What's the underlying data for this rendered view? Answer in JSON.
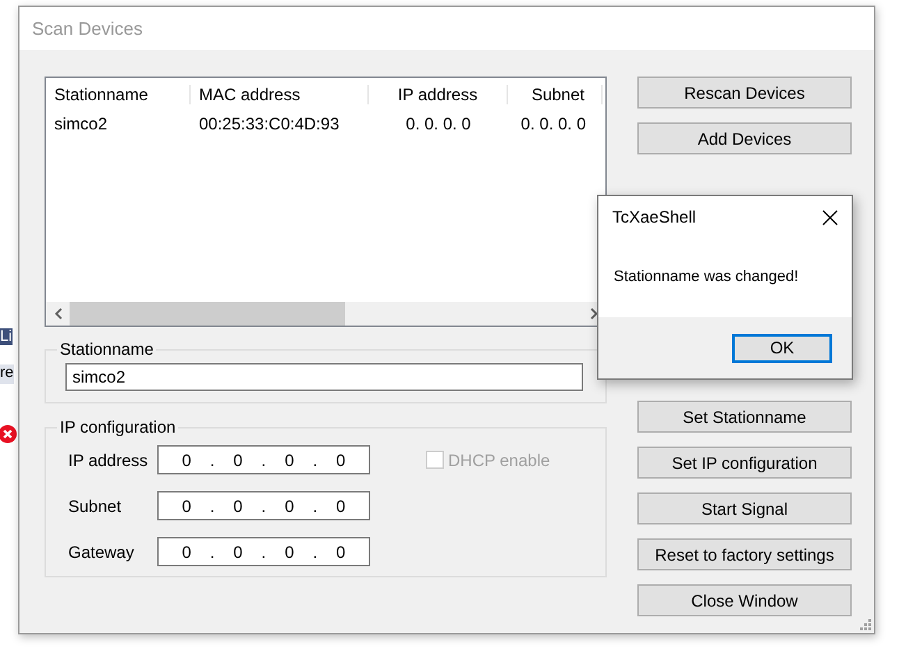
{
  "background": {
    "tab_label": "Li",
    "row_label": "re"
  },
  "dialog": {
    "title": "Scan Devices",
    "device_list": {
      "columns": [
        "Stationname",
        "MAC address",
        "IP address",
        "Subnet"
      ],
      "rows": [
        [
          "simco2",
          "00:25:33:C0:4D:93",
          "0. 0. 0. 0",
          "0. 0. 0. 0"
        ]
      ]
    },
    "stationname_group": {
      "label": "Stationname",
      "value": "simco2"
    },
    "ip_group": {
      "label": "IP configuration",
      "fields": [
        {
          "label": "IP address",
          "octets": [
            "0",
            "0",
            "0",
            "0"
          ],
          "separator": "."
        },
        {
          "label": "Subnet",
          "octets": [
            "0",
            "0",
            "0",
            "0"
          ],
          "separator": "."
        },
        {
          "label": "Gateway",
          "octets": [
            "0",
            "0",
            "0",
            "0"
          ],
          "separator": "."
        }
      ],
      "dhcp": {
        "label": "DHCP enable",
        "checked": false,
        "disabled": true
      }
    },
    "top_buttons": [
      "Rescan Devices",
      "Add Devices"
    ],
    "bottom_buttons": [
      "Set Stationname",
      "Set IP configuration",
      "Start Signal",
      "Reset to factory settings",
      "Close Window"
    ]
  },
  "message_box": {
    "title": "TcXaeShell",
    "message": "Stationname was changed!",
    "button": "OK"
  }
}
